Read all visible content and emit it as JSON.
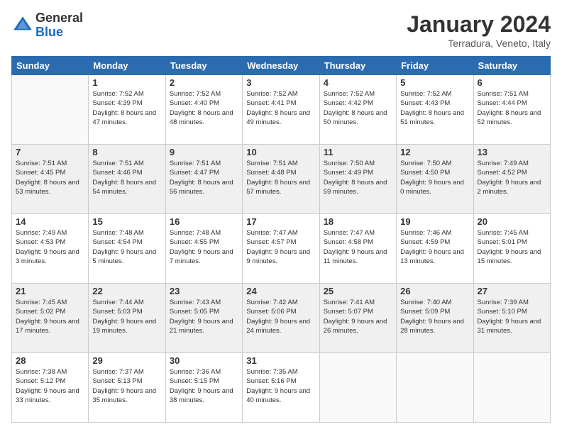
{
  "logo": {
    "general": "General",
    "blue": "Blue"
  },
  "header": {
    "month": "January 2024",
    "location": "Terradura, Veneto, Italy"
  },
  "days": [
    "Sunday",
    "Monday",
    "Tuesday",
    "Wednesday",
    "Thursday",
    "Friday",
    "Saturday"
  ],
  "weeks": [
    [
      {
        "day": "",
        "sunrise": "",
        "sunset": "",
        "daylight": ""
      },
      {
        "day": "1",
        "sunrise": "Sunrise: 7:52 AM",
        "sunset": "Sunset: 4:39 PM",
        "daylight": "Daylight: 8 hours and 47 minutes."
      },
      {
        "day": "2",
        "sunrise": "Sunrise: 7:52 AM",
        "sunset": "Sunset: 4:40 PM",
        "daylight": "Daylight: 8 hours and 48 minutes."
      },
      {
        "day": "3",
        "sunrise": "Sunrise: 7:52 AM",
        "sunset": "Sunset: 4:41 PM",
        "daylight": "Daylight: 8 hours and 49 minutes."
      },
      {
        "day": "4",
        "sunrise": "Sunrise: 7:52 AM",
        "sunset": "Sunset: 4:42 PM",
        "daylight": "Daylight: 8 hours and 50 minutes."
      },
      {
        "day": "5",
        "sunrise": "Sunrise: 7:52 AM",
        "sunset": "Sunset: 4:43 PM",
        "daylight": "Daylight: 8 hours and 51 minutes."
      },
      {
        "day": "6",
        "sunrise": "Sunrise: 7:51 AM",
        "sunset": "Sunset: 4:44 PM",
        "daylight": "Daylight: 8 hours and 52 minutes."
      }
    ],
    [
      {
        "day": "7",
        "sunrise": "Sunrise: 7:51 AM",
        "sunset": "Sunset: 4:45 PM",
        "daylight": "Daylight: 8 hours and 53 minutes."
      },
      {
        "day": "8",
        "sunrise": "Sunrise: 7:51 AM",
        "sunset": "Sunset: 4:46 PM",
        "daylight": "Daylight: 8 hours and 54 minutes."
      },
      {
        "day": "9",
        "sunrise": "Sunrise: 7:51 AM",
        "sunset": "Sunset: 4:47 PM",
        "daylight": "Daylight: 8 hours and 56 minutes."
      },
      {
        "day": "10",
        "sunrise": "Sunrise: 7:51 AM",
        "sunset": "Sunset: 4:48 PM",
        "daylight": "Daylight: 8 hours and 57 minutes."
      },
      {
        "day": "11",
        "sunrise": "Sunrise: 7:50 AM",
        "sunset": "Sunset: 4:49 PM",
        "daylight": "Daylight: 8 hours and 59 minutes."
      },
      {
        "day": "12",
        "sunrise": "Sunrise: 7:50 AM",
        "sunset": "Sunset: 4:50 PM",
        "daylight": "Daylight: 9 hours and 0 minutes."
      },
      {
        "day": "13",
        "sunrise": "Sunrise: 7:49 AM",
        "sunset": "Sunset: 4:52 PM",
        "daylight": "Daylight: 9 hours and 2 minutes."
      }
    ],
    [
      {
        "day": "14",
        "sunrise": "Sunrise: 7:49 AM",
        "sunset": "Sunset: 4:53 PM",
        "daylight": "Daylight: 9 hours and 3 minutes."
      },
      {
        "day": "15",
        "sunrise": "Sunrise: 7:48 AM",
        "sunset": "Sunset: 4:54 PM",
        "daylight": "Daylight: 9 hours and 5 minutes."
      },
      {
        "day": "16",
        "sunrise": "Sunrise: 7:48 AM",
        "sunset": "Sunset: 4:55 PM",
        "daylight": "Daylight: 9 hours and 7 minutes."
      },
      {
        "day": "17",
        "sunrise": "Sunrise: 7:47 AM",
        "sunset": "Sunset: 4:57 PM",
        "daylight": "Daylight: 9 hours and 9 minutes."
      },
      {
        "day": "18",
        "sunrise": "Sunrise: 7:47 AM",
        "sunset": "Sunset: 4:58 PM",
        "daylight": "Daylight: 9 hours and 11 minutes."
      },
      {
        "day": "19",
        "sunrise": "Sunrise: 7:46 AM",
        "sunset": "Sunset: 4:59 PM",
        "daylight": "Daylight: 9 hours and 13 minutes."
      },
      {
        "day": "20",
        "sunrise": "Sunrise: 7:45 AM",
        "sunset": "Sunset: 5:01 PM",
        "daylight": "Daylight: 9 hours and 15 minutes."
      }
    ],
    [
      {
        "day": "21",
        "sunrise": "Sunrise: 7:45 AM",
        "sunset": "Sunset: 5:02 PM",
        "daylight": "Daylight: 9 hours and 17 minutes."
      },
      {
        "day": "22",
        "sunrise": "Sunrise: 7:44 AM",
        "sunset": "Sunset: 5:03 PM",
        "daylight": "Daylight: 9 hours and 19 minutes."
      },
      {
        "day": "23",
        "sunrise": "Sunrise: 7:43 AM",
        "sunset": "Sunset: 5:05 PM",
        "daylight": "Daylight: 9 hours and 21 minutes."
      },
      {
        "day": "24",
        "sunrise": "Sunrise: 7:42 AM",
        "sunset": "Sunset: 5:06 PM",
        "daylight": "Daylight: 9 hours and 24 minutes."
      },
      {
        "day": "25",
        "sunrise": "Sunrise: 7:41 AM",
        "sunset": "Sunset: 5:07 PM",
        "daylight": "Daylight: 9 hours and 26 minutes."
      },
      {
        "day": "26",
        "sunrise": "Sunrise: 7:40 AM",
        "sunset": "Sunset: 5:09 PM",
        "daylight": "Daylight: 9 hours and 28 minutes."
      },
      {
        "day": "27",
        "sunrise": "Sunrise: 7:39 AM",
        "sunset": "Sunset: 5:10 PM",
        "daylight": "Daylight: 9 hours and 31 minutes."
      }
    ],
    [
      {
        "day": "28",
        "sunrise": "Sunrise: 7:38 AM",
        "sunset": "Sunset: 5:12 PM",
        "daylight": "Daylight: 9 hours and 33 minutes."
      },
      {
        "day": "29",
        "sunrise": "Sunrise: 7:37 AM",
        "sunset": "Sunset: 5:13 PM",
        "daylight": "Daylight: 9 hours and 35 minutes."
      },
      {
        "day": "30",
        "sunrise": "Sunrise: 7:36 AM",
        "sunset": "Sunset: 5:15 PM",
        "daylight": "Daylight: 9 hours and 38 minutes."
      },
      {
        "day": "31",
        "sunrise": "Sunrise: 7:35 AM",
        "sunset": "Sunset: 5:16 PM",
        "daylight": "Daylight: 9 hours and 40 minutes."
      },
      {
        "day": "",
        "sunrise": "",
        "sunset": "",
        "daylight": ""
      },
      {
        "day": "",
        "sunrise": "",
        "sunset": "",
        "daylight": ""
      },
      {
        "day": "",
        "sunrise": "",
        "sunset": "",
        "daylight": ""
      }
    ]
  ]
}
